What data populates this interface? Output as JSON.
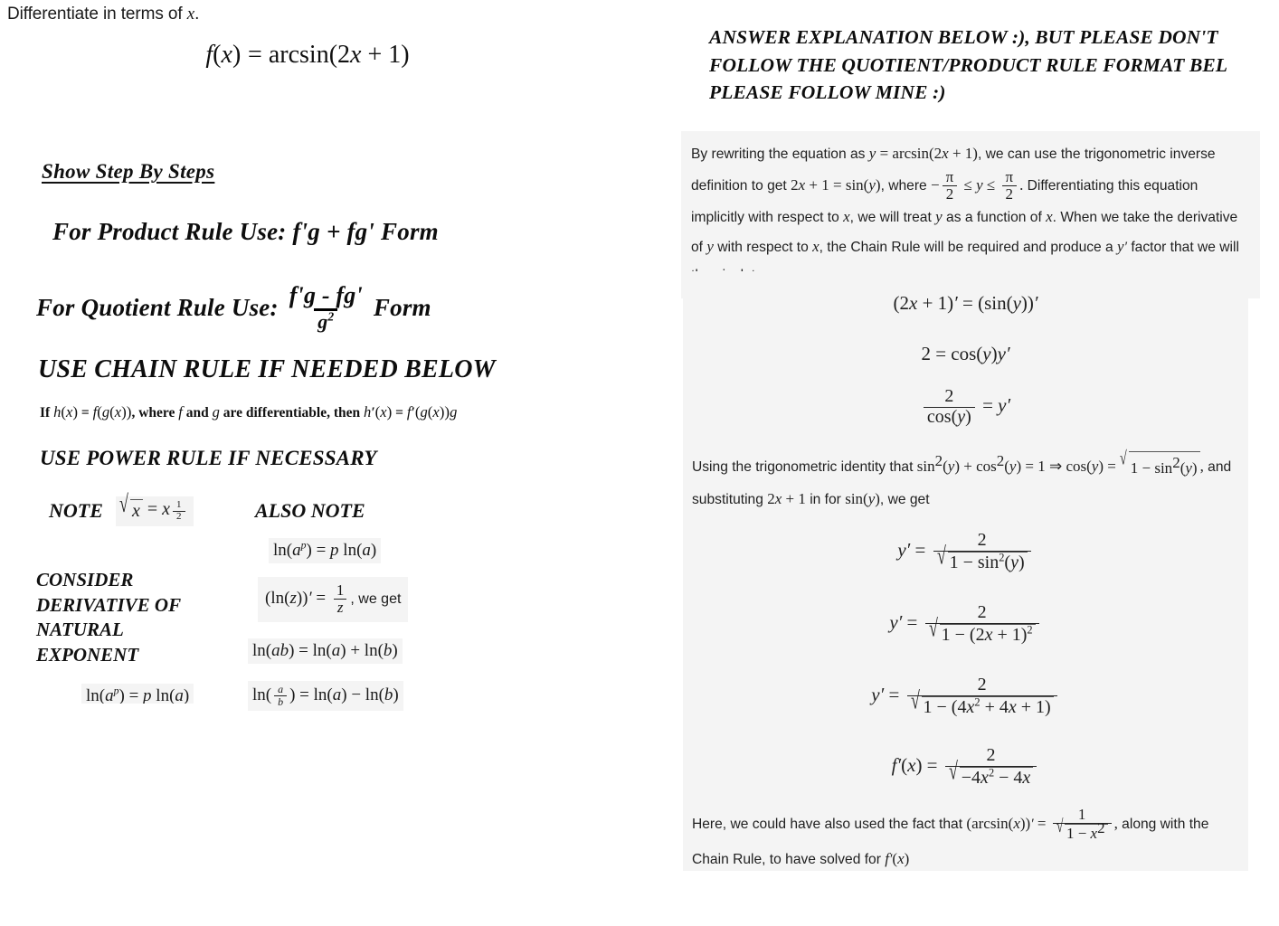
{
  "left": {
    "prompt": "Differentiate in terms of",
    "prompt_var": "x",
    "prompt_period": ".",
    "function_equation": "f(x) = arcsin(2x + 1)",
    "show_steps_heading": "Show Step By Steps",
    "product_rule_text": "For Product Rule Use: f'g + fg' Form",
    "quotient_rule_prefix": "For Quotient Rule Use:",
    "quotient_rule_numerator": "f'g - fg'",
    "quotient_rule_denominator": "g",
    "quotient_rule_denominator_exp": "2",
    "quotient_rule_suffix": "Form",
    "chain_rule_heading": "USE CHAIN RULE IF NEEDED BELOW",
    "chain_rule_statement": "If h(x) = f(g(x)), where f and g are differentiable, then h'(x) = f'(g(x))g",
    "power_rule_heading": "USE POWER RULE IF NECESSARY",
    "note_label": "NOTE",
    "note_sqrt_formula": "√x = x^(1/2)",
    "also_note_label": "ALSO NOTE",
    "consider_block": "CONSIDER\nDERIVATIVE OF\nNATURAL\nEXPONENT",
    "log_power_formula": "ln(a^p) = p ln(a)",
    "log_derivative_formula": "(ln(z))' = 1/z, we get",
    "log_derivative_tail": ", we get",
    "log_product_formula": "ln(ab) = ln(a) + ln(b)",
    "log_quotient_formula": "ln(a/b) = ln(a) - ln(b)",
    "log_power_formula_clipped": "ln(a^p) = p ln(a)"
  },
  "right": {
    "answer_banner": "ANSWER EXPLANATION BELOW :), BUT PLEASE DON'T\nFOLLOW THE QUOTIENT/PRODUCT RULE FORMAT BEL\nPLEASE FOLLOW MINE :)",
    "intro_paragraph": "By rewriting the equation as y = arcsin(2x + 1), we can use the trigonometric inverse definition to get 2x + 1 = sin(y), where -π/2 ≤ y ≤ π/2. Differentiating this equation implicitly with respect to x, we will treat y as a function of x. When we take the derivative of y with respect to x, the Chain Rule will be required and produce a y' factor that we will then isolate.",
    "eq_implicit_1": "(2x + 1)' = (sin(y))'",
    "eq_implicit_2": "2 = cos(y)y'",
    "eq_implicit_3": "2/cos(y) = y'",
    "identity_paragraph": "Using the trigonometric identity that sin²(y) + cos²(y) = 1 ⇒ cos(y) = √(1 - sin²(y)), and substituting 2x + 1 in for sin(y), we get",
    "eq_sub_1": "y' = 2/√(1 - sin²(y))",
    "eq_sub_2": "y' = 2/√(1 - (2x + 1)²)",
    "eq_sub_3": "y' = 2/√(1 - (4x² + 4x + 1))",
    "eq_sub_4": "f'(x) = 2/√(-4x² - 4x)",
    "closing_paragraph": "Here, we could have also used the fact that (arcsin(x))' = 1/√(1 - x²), along with the Chain Rule, to have solved for f'(x)"
  },
  "colors": {
    "page_background": "#ffffff",
    "panel_background": "#f4f4f4",
    "text": "#1f1f1f",
    "heading_text": "#0d0d0d"
  }
}
